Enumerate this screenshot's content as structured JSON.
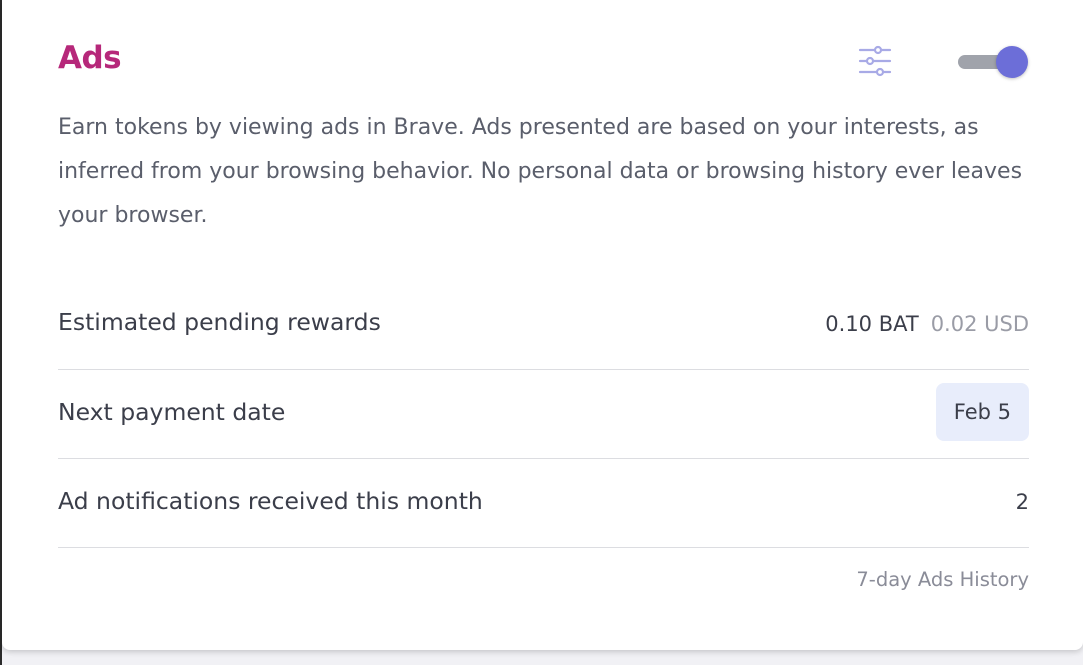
{
  "card": {
    "title": "Ads",
    "settings_icon": "sliders-icon",
    "toggle": {
      "state": "on",
      "accent": "#6c6ed8"
    },
    "description": "Earn tokens by viewing ads in Brave. Ads presented are based on your interests, as inferred from your browsing behavior. No personal data or browsing history ever leaves your browser."
  },
  "rows": [
    {
      "label": "Estimated pending rewards",
      "bat": "0.10 BAT",
      "usd": "0.02 USD"
    },
    {
      "label": "Next payment date",
      "value": "Feb 5"
    },
    {
      "label": "Ad notifications received this month",
      "value": "2"
    }
  ],
  "footer": {
    "history_link": "7-day Ads History"
  },
  "colors": {
    "title": "#b6287a",
    "text": "#3b3e4a",
    "muted": "#9a9ca6",
    "chip_bg": "#e8edfb"
  }
}
